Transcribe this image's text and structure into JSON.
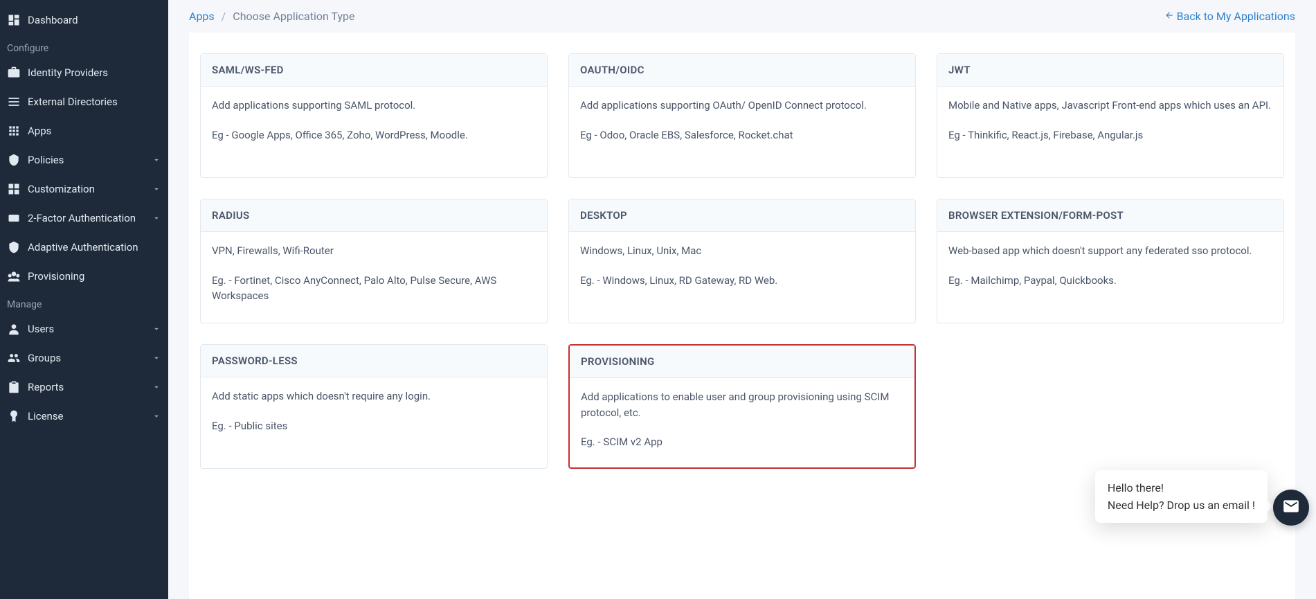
{
  "sidebar": {
    "dashboard": "Dashboard",
    "sections": {
      "configure": "Configure",
      "manage": "Manage"
    },
    "items": {
      "identity_providers": "Identity Providers",
      "external_directories": "External Directories",
      "apps": "Apps",
      "policies": "Policies",
      "customization": "Customization",
      "two_factor": "2-Factor Authentication",
      "adaptive_auth": "Adaptive Authentication",
      "provisioning": "Provisioning",
      "users": "Users",
      "groups": "Groups",
      "reports": "Reports",
      "license": "License"
    }
  },
  "breadcrumb": {
    "apps": "Apps",
    "sep": "/",
    "current": "Choose Application Type"
  },
  "back_link": "Back to My Applications",
  "cards": [
    {
      "title": "SAML/WS-FED",
      "desc": "Add applications supporting SAML protocol.",
      "eg": "Eg - Google Apps, Office 365, Zoho, WordPress, Moodle."
    },
    {
      "title": "OAUTH/OIDC",
      "desc": "Add applications supporting OAuth/ OpenID Connect protocol.",
      "eg": "Eg - Odoo, Oracle EBS, Salesforce, Rocket.chat"
    },
    {
      "title": "JWT",
      "desc": "Mobile and Native apps, Javascript Front-end apps which uses an API.",
      "eg": "Eg - Thinkific, React.js, Firebase, Angular.js"
    },
    {
      "title": "RADIUS",
      "desc": "VPN, Firewalls, Wifi-Router",
      "eg": "Eg. - Fortinet, Cisco AnyConnect, Palo Alto, Pulse Secure, AWS Workspaces"
    },
    {
      "title": "DESKTOP",
      "desc": "Windows, Linux, Unix, Mac",
      "eg": "Eg. - Windows, Linux, RD Gateway, RD Web."
    },
    {
      "title": "BROWSER EXTENSION/FORM-POST",
      "desc": "Web-based app which doesn't support any federated sso protocol.",
      "eg": "Eg. - Mailchimp, Paypal, Quickbooks."
    },
    {
      "title": "PASSWORD-LESS",
      "desc": "Add static apps which doesn't require any login.",
      "eg": "Eg. - Public sites"
    },
    {
      "title": "PROVISIONING",
      "desc": "Add applications to enable user and group provisioning using SCIM protocol, etc.",
      "eg": "Eg. - SCIM v2 App"
    }
  ],
  "chat": {
    "line1": "Hello there!",
    "line2": "Need Help? Drop us an email !"
  }
}
